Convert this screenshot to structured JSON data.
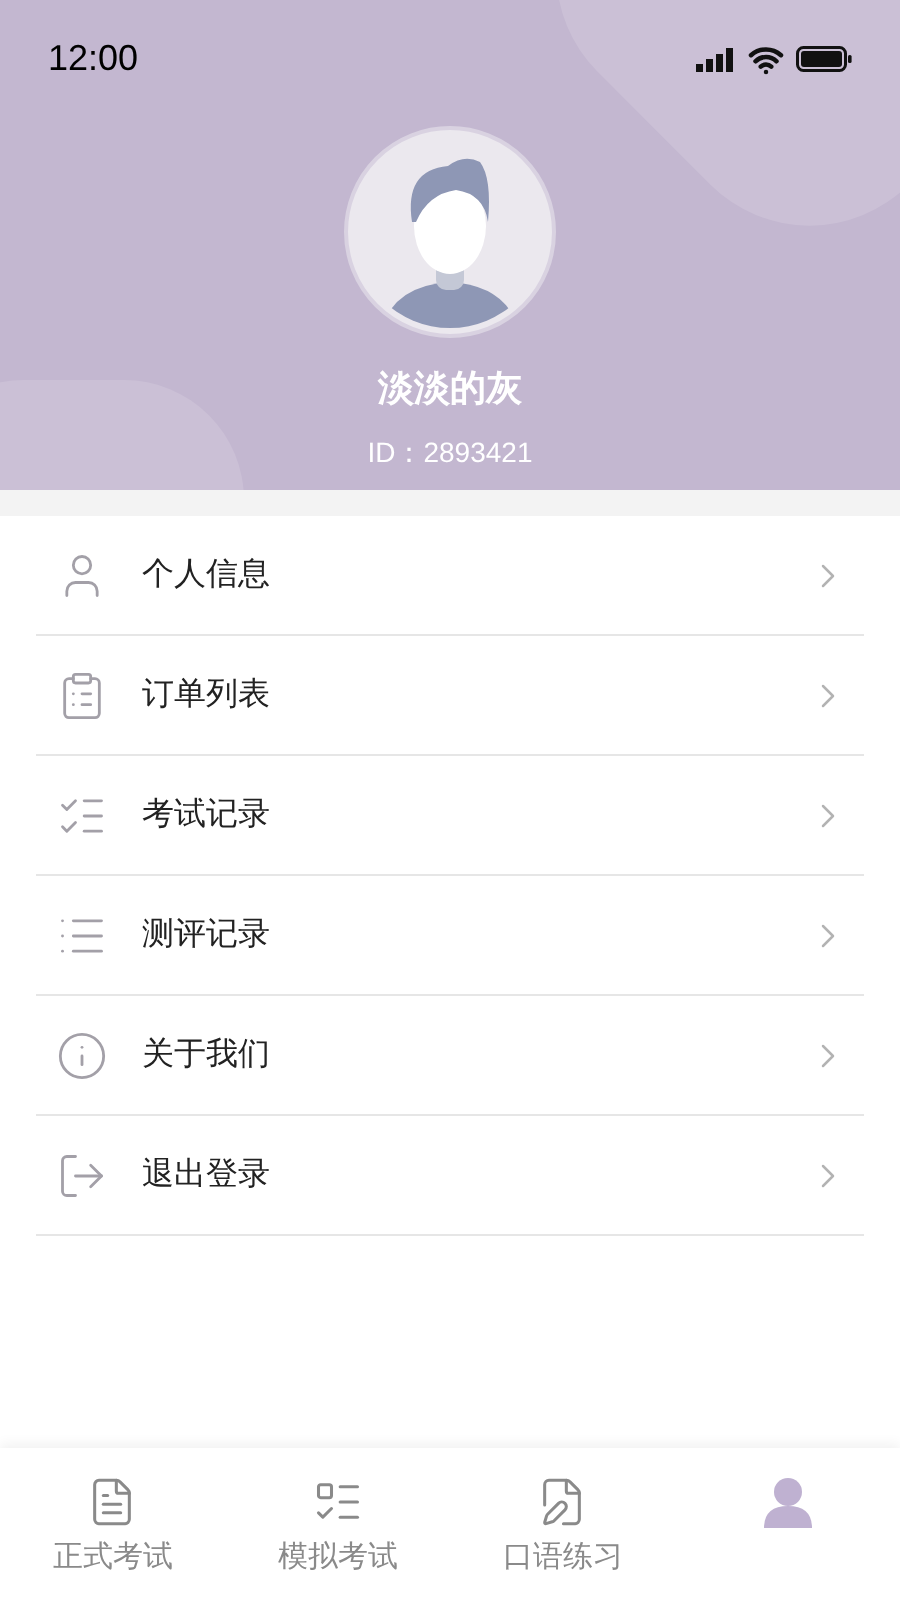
{
  "status_bar": {
    "time": "12:00"
  },
  "profile": {
    "name": "淡淡的灰",
    "user_id": "ID：2893421"
  },
  "menu": [
    {
      "label": "个人信息"
    },
    {
      "label": "订单列表"
    },
    {
      "label": "考试记录"
    },
    {
      "label": "测评记录"
    },
    {
      "label": "关于我们"
    },
    {
      "label": "退出登录"
    }
  ],
  "tab_bar": [
    {
      "label": "正式考试",
      "selected": false
    },
    {
      "label": "模拟考试",
      "selected": false
    },
    {
      "label": "口语练习",
      "selected": false
    },
    {
      "selected": true
    }
  ]
}
